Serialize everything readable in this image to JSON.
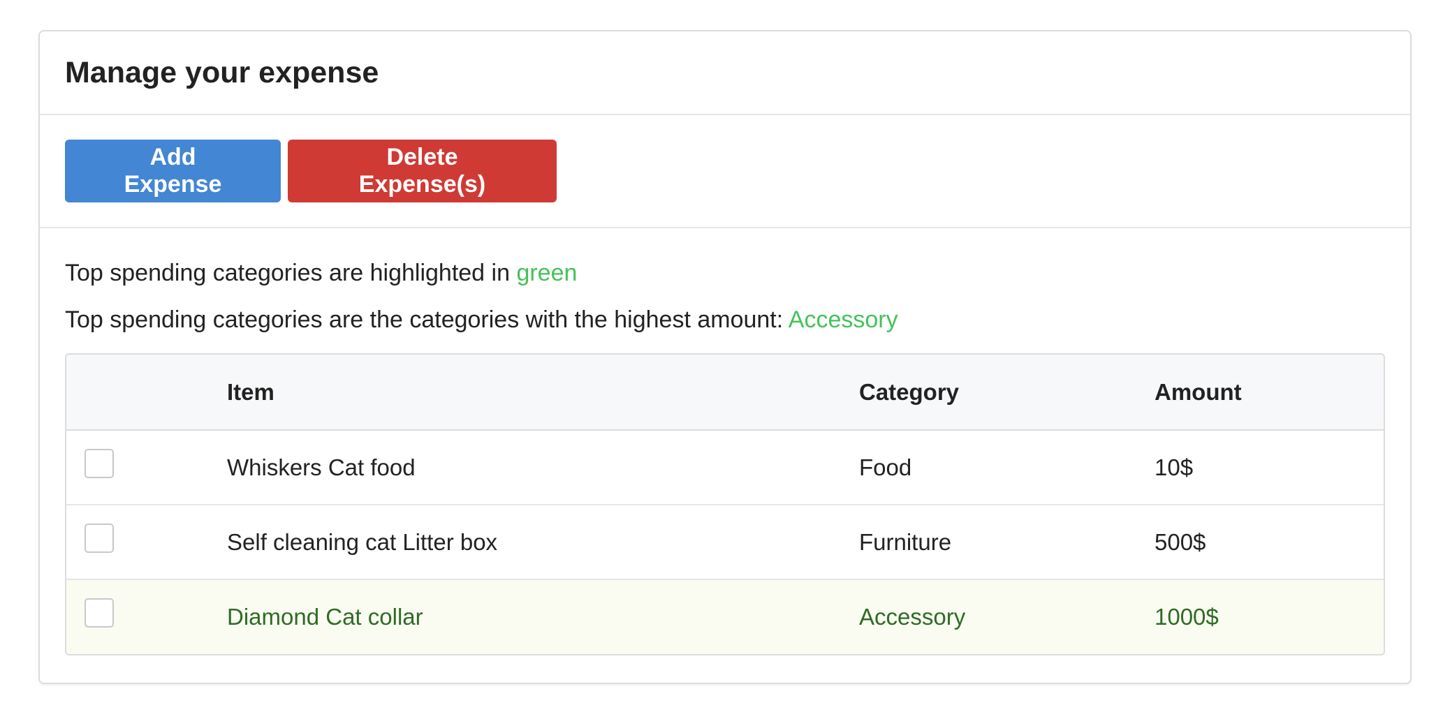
{
  "header": {
    "title": "Manage your expense"
  },
  "toolbar": {
    "add_label": "Add Expense",
    "delete_label": "Delete Expense(s)"
  },
  "notes": {
    "highlight_prefix": "Top spending categories are highlighted in ",
    "highlight_color_word": "green",
    "top_prefix": "Top spending categories are the categories with the highest amount: ",
    "top_category": "Accessory"
  },
  "table": {
    "headers": [
      "Item",
      "Category",
      "Amount"
    ],
    "rows": [
      {
        "item": "Whiskers Cat food",
        "category": "Food",
        "amount": "10$",
        "checked": false,
        "highlighted": false
      },
      {
        "item": "Self cleaning cat Litter box",
        "category": "Furniture",
        "amount": "500$",
        "checked": false,
        "highlighted": false
      },
      {
        "item": "Diamond Cat collar",
        "category": "Accessory",
        "amount": "1000$",
        "checked": false,
        "highlighted": true
      }
    ]
  },
  "colors": {
    "add_button": "#4386d3",
    "delete_button": "#cf3a35",
    "highlight_text": "#44c25a",
    "highlight_row_text": "#2f6b24",
    "highlight_row_bg": "#fafcf2"
  }
}
